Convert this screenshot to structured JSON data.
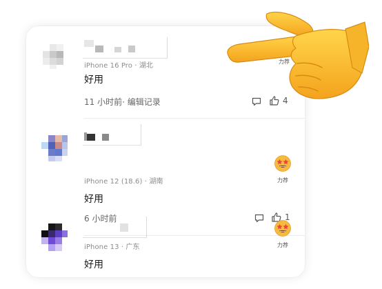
{
  "colors": {
    "card_bg": "#ffffff",
    "text_primary": "#1a1a1a",
    "text_meta": "#8a8a8a",
    "icon_stroke": "#555555",
    "emoji_yellow": "#f7b93e"
  },
  "comments": [
    {
      "device_location": "iPhone 16 Pro · 湖北",
      "body": "好用",
      "time_label": "11 小时前· 编辑记录",
      "reply_icon": "comment-bubble-icon",
      "like_icon": "thumbs-up-icon",
      "like_count": "4",
      "recommend_label": "力荐"
    },
    {
      "device_location": "iPhone 12 (18.6) · 湖南",
      "body": "好用",
      "time_label": "6 小时前",
      "reply_icon": "comment-bubble-icon",
      "like_icon": "thumbs-up-icon",
      "like_count": "1",
      "recommend_label": "力荐"
    },
    {
      "device_location": "iPhone 13 · 广东",
      "body": "好用",
      "recommend_label": "力荐"
    }
  ],
  "overlay": {
    "icon": "pointing-hand-emoji-icon"
  }
}
